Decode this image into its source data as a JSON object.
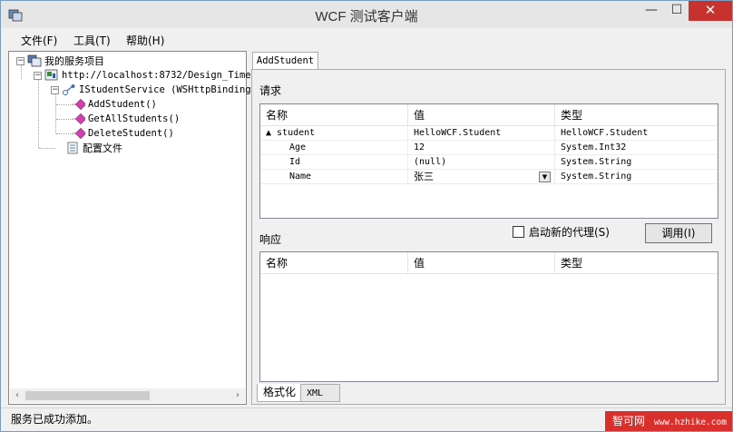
{
  "window": {
    "title": "WCF 测试客户端",
    "controls": {
      "minimize": "—",
      "maximize": "☐",
      "close": "✕"
    }
  },
  "menu": [
    {
      "label": "文件(F)"
    },
    {
      "label": "工具(T)"
    },
    {
      "label": "帮助(H)"
    }
  ],
  "tree": {
    "root": "我的服务项目",
    "endpoint": "http://localhost:8732/Design_Time",
    "service": "IStudentService (WSHttpBinding",
    "operations": [
      "AddStudent()",
      "GetAllStudents()",
      "DeleteStudent()"
    ],
    "config": "配置文件",
    "expander_minus": "−"
  },
  "tab": {
    "label": "AddStudent"
  },
  "request": {
    "label": "请求",
    "columns": [
      "名称",
      "值",
      "类型"
    ],
    "rows": [
      {
        "name": "▲ student",
        "value": "HelloWCF.Student",
        "type": "HelloWCF.Student"
      },
      {
        "name": "Age",
        "value": "12",
        "type": "System.Int32"
      },
      {
        "name": "Id",
        "value": "(null)",
        "type": "System.String"
      },
      {
        "name": "Name",
        "value": "张三",
        "type": "System.String"
      }
    ],
    "dropdown_glyph": "▼"
  },
  "options": {
    "new_proxy_label": "启动新的代理(S)",
    "new_proxy_checked": false,
    "invoke_label": "调用(I)"
  },
  "response": {
    "label": "响应",
    "columns": [
      "名称",
      "值",
      "类型"
    ]
  },
  "bottom_tabs": {
    "formatted": "格式化",
    "xml": "XML"
  },
  "status": {
    "text": "服务已成功添加。"
  },
  "watermark": {
    "brand": "智可网",
    "url": "www.hzhike.com"
  },
  "scrollbar": {
    "left_arrow": "‹",
    "right_arrow": "›"
  },
  "colors": {
    "close_button": "#c7312e",
    "watermark_bg": "#d9302e",
    "operation_icon": "#d63fb0"
  }
}
